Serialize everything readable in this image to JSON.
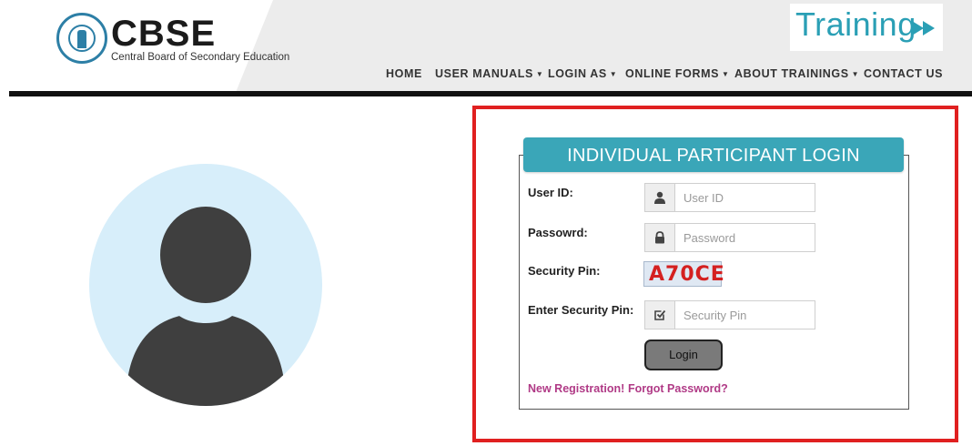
{
  "header": {
    "brand": "CBSE",
    "brand_subtitle": "Central Board of Secondary Education",
    "training_label": "Training",
    "accent": "#2a9fb5"
  },
  "nav": {
    "items": [
      {
        "label": "HOME",
        "dropdown": false
      },
      {
        "label": "USER MANUALS",
        "dropdown": true
      },
      {
        "label": "LOGIN AS",
        "dropdown": true
      },
      {
        "label": "ONLINE FORMS",
        "dropdown": true
      },
      {
        "label": "ABOUT TRAININGS",
        "dropdown": true
      },
      {
        "label": "CONTACT US",
        "dropdown": false
      }
    ]
  },
  "login": {
    "title": "INDIVIDUAL PARTICIPANT LOGIN",
    "header_color": "#3aa6b8",
    "user_id_label": "User ID:",
    "user_id_placeholder": "User ID",
    "password_label": "Passowrd:",
    "password_placeholder": "Password",
    "security_pin_label": "Security Pin:",
    "captcha": "A70CE",
    "enter_pin_label": "Enter Security Pin:",
    "enter_pin_placeholder": "Security Pin",
    "login_button": "Login",
    "new_registration": "New Registration!",
    "forgot_password": "Forgot Password?",
    "link_color": "#b03a86",
    "highlight_color": "#e02020"
  },
  "icons": {
    "user": "user-icon",
    "password": "lock-icon",
    "pin": "checkbox-icon",
    "training_arrow": "fast-forward-icon"
  }
}
